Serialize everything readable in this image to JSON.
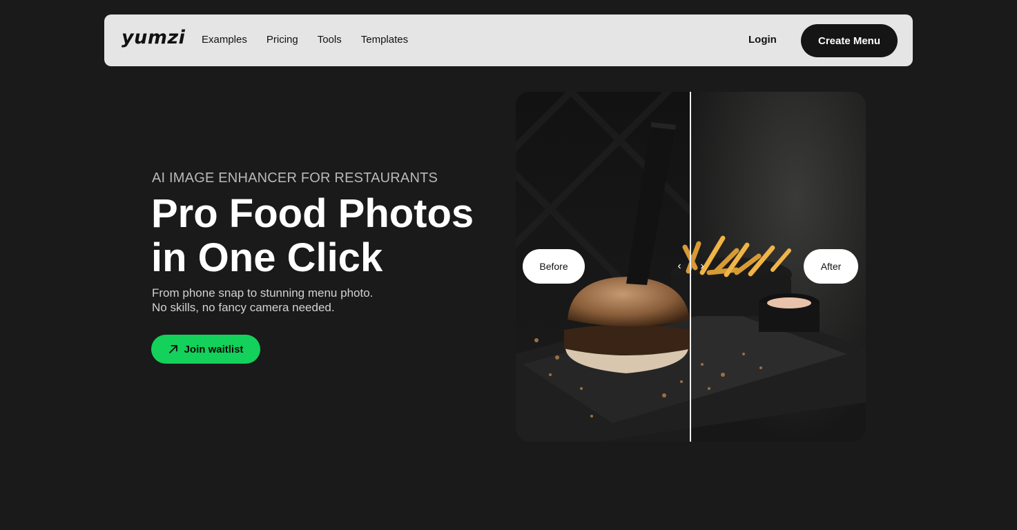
{
  "nav": {
    "logo": "yumzi",
    "links": [
      "Examples",
      "Pricing",
      "Tools",
      "Templates"
    ],
    "login": "Login",
    "cta": "Create Menu"
  },
  "hero": {
    "eyebrow": "AI IMAGE ENHANCER FOR RESTAURANTS",
    "headline_line1": "Pro Food Photos",
    "headline_line2": "in One Click",
    "subtext_line1": "From phone snap to stunning menu photo.",
    "subtext_line2": "No skills, no fancy camera needed.",
    "cta": "Join waitlist",
    "cta_icon": "arrow-up-right-icon"
  },
  "comparison": {
    "before_label": "Before",
    "after_label": "After",
    "left_icon": "chevron-left-icon",
    "right_icon": "chevron-right-icon",
    "image": "burger-and-fries-photo"
  },
  "colors": {
    "page_bg": "#1a1a1a",
    "nav_bg": "#e5e5e5",
    "dark_button": "#151515",
    "accent_green": "#13d15a"
  }
}
